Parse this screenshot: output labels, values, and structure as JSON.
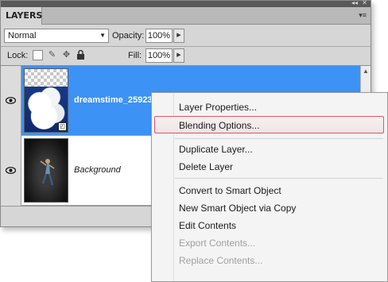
{
  "panel": {
    "tab_label": "LAYERS",
    "collapse_glyph": "◂◂",
    "close_glyph": "✕",
    "menu_glyph": "▾≡",
    "blend_mode": "Normal",
    "opacity_label": "Opacity:",
    "opacity_value": "100%",
    "lock_label": "Lock:",
    "fill_label": "Fill:",
    "fill_value": "100%"
  },
  "layers": [
    {
      "name": "dreamstime_25923",
      "selected": true,
      "visible": true,
      "thumbnail": "clouds-smart-object"
    },
    {
      "name": "Background",
      "selected": false,
      "visible": true,
      "thumbnail": "dancer-photo"
    }
  ],
  "context_menu": {
    "items": [
      {
        "label": "Layer Properties...",
        "enabled": true
      },
      {
        "label": "Blending Options...",
        "enabled": true,
        "highlighted": true
      },
      {
        "label": "Duplicate Layer...",
        "enabled": true
      },
      {
        "label": "Delete Layer",
        "enabled": true
      },
      {
        "label": "Convert to Smart Object",
        "enabled": true
      },
      {
        "label": "New Smart Object via Copy",
        "enabled": true
      },
      {
        "label": "Edit Contents",
        "enabled": true
      },
      {
        "label": "Export Contents...",
        "enabled": false
      },
      {
        "label": "Replace Contents...",
        "enabled": false
      }
    ]
  },
  "colors": {
    "selection": "#3d92f5",
    "highlight_border": "#e05560",
    "panel_bg": "#d6d6d6"
  }
}
